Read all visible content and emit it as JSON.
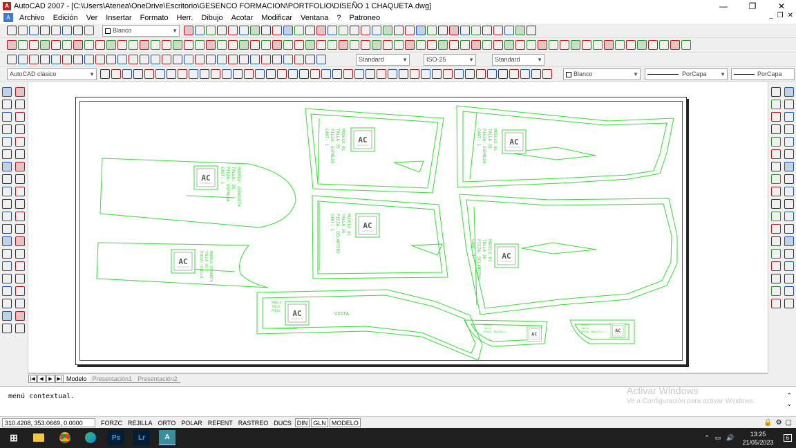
{
  "window": {
    "title": "AutoCAD 2007 - [C:\\Users\\Atenea\\OneDrive\\Escritorio\\GESENCO FORMACION\\PORTFOLIO\\DISEÑO 1 CHAQUETA.dwg]",
    "minimize": "—",
    "maximize": "❐",
    "close": "✕"
  },
  "menu": [
    "Archivo",
    "Edición",
    "Ver",
    "Insertar",
    "Formato",
    "Herr.",
    "Dibujo",
    "Acotar",
    "Modificar",
    "Ventana",
    "?",
    "Patroneo"
  ],
  "toolbar": {
    "layer_color": "Blanco",
    "text_style": "Standard",
    "dim_style": "ISO-25",
    "table_style": "Standard",
    "workspace": "AutoCAD clásico",
    "color_control": "Blanco",
    "linetype": "PorCapa",
    "lineweight": "PorCapa"
  },
  "tabs": {
    "model": "Modelo",
    "layout1": "Presentación1",
    "layout2": "Presentación2"
  },
  "command": {
    "text": "menú contextual."
  },
  "watermark": {
    "line1": "Activar Windows",
    "line2": "Ve a Configuración para activar Windows."
  },
  "status": {
    "coords": "310.4208, 353.0669, 0.0000",
    "toggles": [
      "FORZC",
      "REJILLA",
      "ORTO",
      "POLAR",
      "REFENT",
      "RASTREO",
      "DUCS",
      "DIN",
      "GLN",
      "MODELO"
    ],
    "active": [
      "DIN",
      "GLN",
      "MODELO"
    ]
  },
  "taskbar": {
    "time": "13:25",
    "date": "21/05/2023",
    "apps": [
      "explorer",
      "chrome",
      "edge",
      "photoshop",
      "lightroom",
      "autocad"
    ],
    "app_labels": {
      "photoshop": "Ps",
      "lightroom": "Lr",
      "autocad": "A"
    },
    "notification_count": "6"
  },
  "drawing": {
    "line_color": "#33dd33",
    "logo_text": "AC",
    "pieces": [
      {
        "id": "manga-bajo",
        "label": [
          "MODELO 01",
          "TALLA 36",
          "PIEZA: ESPALDA",
          "CANT: 1"
        ]
      },
      {
        "id": "espalda",
        "label": [
          "MODELO 01",
          "TALLA 36",
          "PIEZA: ESPALDA",
          "CANT: 1"
        ]
      },
      {
        "id": "manga-top",
        "label": [
          "MODELO: CHAQUETA",
          "TALLA: 36",
          "PIEZA: ESPALDA",
          "CANT: 1"
        ]
      },
      {
        "id": "delantero-lat",
        "label": [
          "MODELO 01",
          "TALLA 36",
          "PIEZA: DELANTERO",
          "CANT: 1"
        ]
      },
      {
        "id": "delantero",
        "label": [
          "MODELO 01",
          "TALLA 36",
          "PIEZA: DELANTERO",
          "CANT: 1"
        ]
      },
      {
        "id": "cuello",
        "label": [
          "MODELO CHAQUETA",
          "TALLA 36",
          "PIEZA: CUELLO"
        ]
      },
      {
        "id": "vista",
        "label": [
          "MODELO",
          "TALLA",
          "PIEZA"
        ],
        "title": "VISTA"
      },
      {
        "id": "bolsillo1",
        "label": [
          "MODELO",
          "TALLA",
          "PIEZA: BOLSILLO"
        ]
      },
      {
        "id": "bolsillo2",
        "label": [
          "MODELO",
          "TALLA",
          "PIEZA: BOLSILLO"
        ]
      }
    ]
  }
}
